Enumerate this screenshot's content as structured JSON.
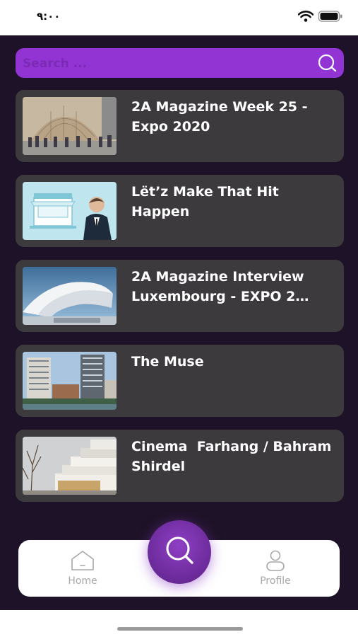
{
  "status_bar": {
    "time": "٩:٠٠"
  },
  "search": {
    "placeholder": "Search ..."
  },
  "articles": [
    {
      "title": "2A Magazine Week 25 - Expo 2020"
    },
    {
      "title": "Lët’z Make That Hit Happen"
    },
    {
      "title": "2A Magazine Interview Luxembourg - EXPO 2…"
    },
    {
      "title": "The Muse"
    },
    {
      "title": "Cinema  Farhang / Bahram Shirdel"
    }
  ],
  "tabbar": {
    "home_label": "Home",
    "profile_label": "Profile"
  },
  "colors": {
    "accent": "#9233d4",
    "background": "#1e1228",
    "card": "#3d3a3e",
    "fab": "#6a2a99"
  }
}
